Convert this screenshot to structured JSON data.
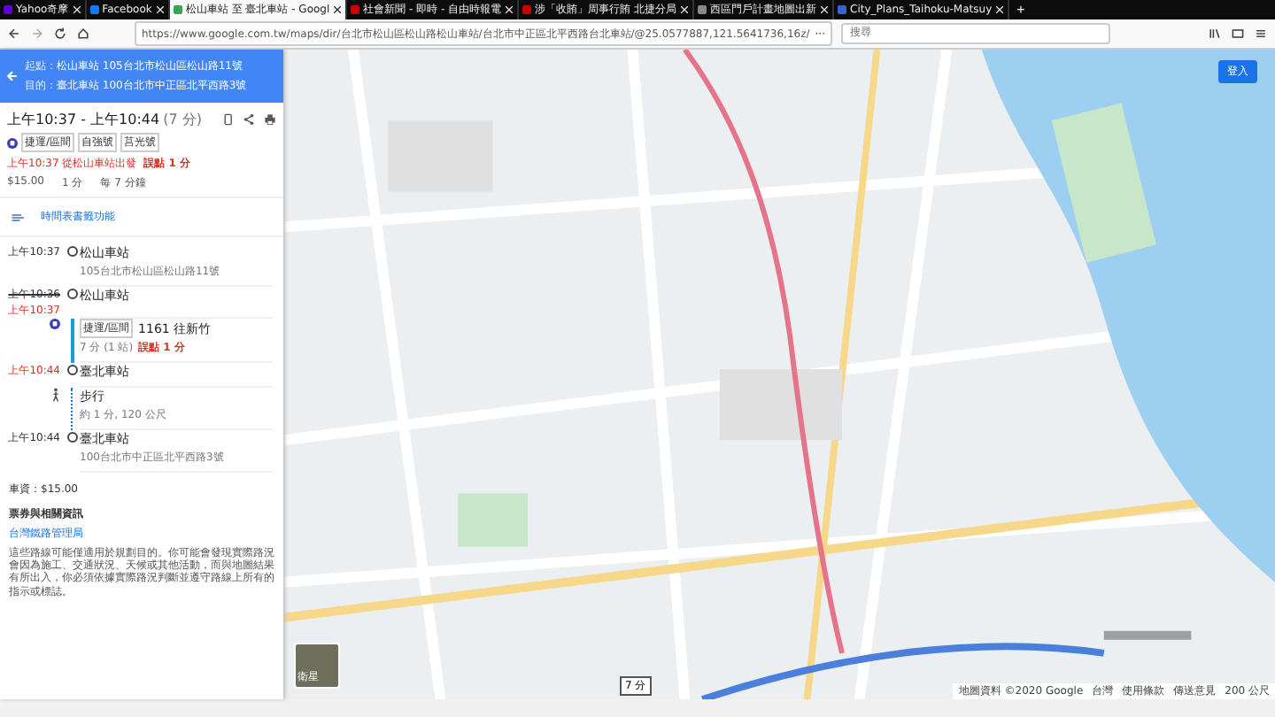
{
  "browser": {
    "tabs": [
      {
        "label": "Yahoo奇摩",
        "selected": false,
        "kind": "yahoo"
      },
      {
        "label": "Facebook",
        "selected": false,
        "kind": "facebook"
      },
      {
        "label": "松山車站 至 臺北車站 - Googl",
        "selected": true,
        "kind": "maps"
      },
      {
        "label": "社會新聞 - 即時 - 自由時報電",
        "selected": false,
        "kind": "news"
      },
      {
        "label": "涉「收賄」周事行賄 北捷分局",
        "selected": false,
        "kind": "news"
      },
      {
        "label": "西區門戶計畫地圖出新",
        "selected": false,
        "kind": "plain"
      },
      {
        "label": "City_Plans_Taihoku-Matsuy",
        "selected": false,
        "kind": "wiki"
      }
    ],
    "new_tab": "+",
    "url": "https://www.google.com.tw/maps/dir/台北市松山區松山路松山車站/台北市中正區北平西路台北車站/@25.0577887,121.5641736,16z/",
    "more": "···",
    "search": {
      "placeholder": "搜尋"
    }
  },
  "directions": {
    "fields": [
      {
        "label": "起點：",
        "value": "松山車站 105台北市松山區松山路11號"
      },
      {
        "label": "目的：",
        "value": "臺北車站 100台北市中正區北平西路3號"
      }
    ],
    "time": "上午10:37 - 上午10:44",
    "duration": "(7 分)",
    "tags": [
      "捷運/區間",
      "自強號",
      "莒光號"
    ],
    "depart": "上午10:37 從松山車站出發",
    "depart_delay": "誤點 1 分",
    "fare": "$15.00",
    "wait": "1 分",
    "frequency": "每 7 分鐘",
    "bookmark": "時間表書籤功能",
    "steps": [
      {
        "kind": "stop",
        "time": "上午10:37",
        "delayed": false,
        "name": "松山車站",
        "address": "105台北市松山區松山路11號"
      },
      {
        "kind": "stop",
        "scheduled": "上午10:36",
        "time": "上午10:37",
        "delayed": true,
        "name": "松山車站"
      },
      {
        "kind": "transit",
        "tag": "捷運/區間",
        "route": "1161 往新竹",
        "detail": "7 分 (1 站)",
        "delay": "誤點 1 分"
      },
      {
        "kind": "stop",
        "time": "上午10:44",
        "delayed": true,
        "name": "臺北車站"
      },
      {
        "kind": "walk",
        "name": "步行",
        "detail": "約 1 分, 120 公尺"
      },
      {
        "kind": "stop",
        "time": "上午10:44",
        "delayed": false,
        "name": "臺北車站",
        "address": "100台北市中正區北平西路3號"
      }
    ],
    "total_fare": "車資：$15.00",
    "tickets_heading": "票券與相關資訊",
    "agency": "台灣鐵路管理局",
    "disclaimer": "這些路線可能僅適用於規劃目的。你可能會發現實際路況會因為施工、交通狀況、天候或其他活動，而與地圖結果有所出入，你必須依據實際路況判斷並遵守路線上所有的指示或標誌。"
  },
  "map": {
    "sign_in": "登入",
    "layer_label": "衛星",
    "route_chip": "7 分",
    "attribution": [
      "地圖資料 ©2020 Google",
      "台灣",
      "使用條款",
      "傳送意見",
      "200 公尺"
    ]
  }
}
